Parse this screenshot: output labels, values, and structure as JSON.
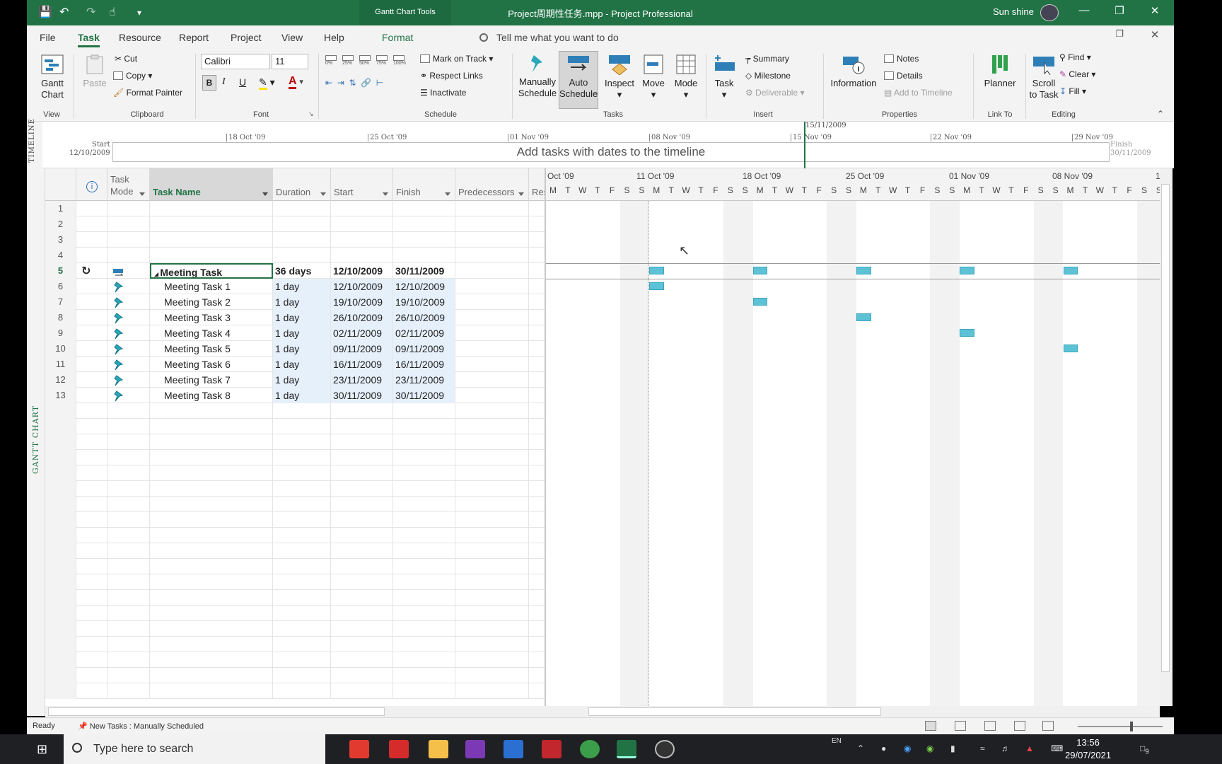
{
  "window": {
    "context_tab": "Gantt Chart Tools",
    "title": "Project周期性任务.mpp  -  Project Professional",
    "user": "Sun shine"
  },
  "menu": {
    "items": [
      "File",
      "Task",
      "Resource",
      "Report",
      "Project",
      "View",
      "Help",
      "Format"
    ],
    "active": "Task",
    "tell_me": "Tell me what you want to do"
  },
  "ribbon": {
    "view": {
      "gantt_chart": "Gantt\nChart",
      "label": "View"
    },
    "clipboard": {
      "paste": "Paste",
      "cut": "Cut",
      "copy": "Copy",
      "format_painter": "Format Painter",
      "label": "Clipboard"
    },
    "font": {
      "family": "Calibri",
      "size": "11",
      "bold": "B",
      "italic": "I",
      "underline": "U",
      "label": "Font"
    },
    "schedule": {
      "progress": [
        "0%",
        "25%",
        "50%",
        "75%",
        "100%"
      ],
      "mark_on_track": "Mark on Track",
      "respect_links": "Respect Links",
      "inactivate": "Inactivate",
      "label": "Schedule"
    },
    "tasks": {
      "manually": "Manually\nSchedule",
      "auto": "Auto\nSchedule",
      "inspect": "Inspect",
      "move": "Move",
      "mode": "Mode",
      "label": "Tasks"
    },
    "insert": {
      "task": "Task",
      "summary": "Summary",
      "milestone": "Milestone",
      "deliverable": "Deliverable",
      "label": "Insert"
    },
    "properties": {
      "information": "Information",
      "notes": "Notes",
      "details": "Details",
      "add_to_timeline": "Add to Timeline",
      "label": "Properties"
    },
    "link_to": {
      "planner": "Planner",
      "label": "Link To"
    },
    "editing": {
      "scroll_to_task": "Scroll\nto Task",
      "find": "Find",
      "clear": "Clear",
      "fill": "Fill",
      "label": "Editing"
    }
  },
  "timeline": {
    "side_label": "TIMELINE",
    "start_label": "Start",
    "start_date": "12/10/2009",
    "finish_label": "Finish",
    "finish_date": "30/11/2009",
    "current_date": "15/11/2009",
    "ticks": [
      "18 Oct '09",
      "25 Oct '09",
      "01 Nov '09",
      "08 Nov '09",
      "15 Nov '09",
      "22 Nov '09",
      "29 Nov '09"
    ],
    "placeholder": "Add tasks with dates to the timeline"
  },
  "sheet": {
    "side_label": "GANTT CHART",
    "columns": {
      "mode": "Task\nMode",
      "name": "Task Name",
      "duration": "Duration",
      "start": "Start",
      "finish": "Finish",
      "predecessors": "Predecessors",
      "resources": "Res"
    },
    "rows": [
      {
        "id": "1",
        "name": "",
        "duration": "",
        "start": "",
        "finish": ""
      },
      {
        "id": "2",
        "name": "",
        "duration": "",
        "start": "",
        "finish": ""
      },
      {
        "id": "3",
        "name": "",
        "duration": "",
        "start": "",
        "finish": ""
      },
      {
        "id": "4",
        "name": "",
        "duration": "",
        "start": "",
        "finish": ""
      },
      {
        "id": "5",
        "name": "Meeting Task",
        "duration": "36 days",
        "start": "12/10/2009",
        "finish": "30/11/2009",
        "summary": true
      },
      {
        "id": "6",
        "name": "Meeting Task 1",
        "duration": "1 day",
        "start": "12/10/2009",
        "finish": "12/10/2009"
      },
      {
        "id": "7",
        "name": "Meeting Task 2",
        "duration": "1 day",
        "start": "19/10/2009",
        "finish": "19/10/2009"
      },
      {
        "id": "8",
        "name": "Meeting Task 3",
        "duration": "1 day",
        "start": "26/10/2009",
        "finish": "26/10/2009"
      },
      {
        "id": "9",
        "name": "Meeting Task 4",
        "duration": "1 day",
        "start": "02/11/2009",
        "finish": "02/11/2009"
      },
      {
        "id": "10",
        "name": "Meeting Task 5",
        "duration": "1 day",
        "start": "09/11/2009",
        "finish": "09/11/2009"
      },
      {
        "id": "11",
        "name": "Meeting Task 6",
        "duration": "1 day",
        "start": "16/11/2009",
        "finish": "16/11/2009"
      },
      {
        "id": "12",
        "name": "Meeting Task 7",
        "duration": "1 day",
        "start": "23/11/2009",
        "finish": "23/11/2009"
      },
      {
        "id": "13",
        "name": "Meeting Task 8",
        "duration": "1 day",
        "start": "30/11/2009",
        "finish": "30/11/2009"
      }
    ]
  },
  "gantt": {
    "weeks": [
      "Oct '09",
      "11 Oct '09",
      "18 Oct '09",
      "25 Oct '09",
      "01 Nov '09",
      "08 Nov '09",
      "1"
    ],
    "days": [
      "M",
      "T",
      "W",
      "T",
      "F",
      "S",
      "S",
      "M",
      "T",
      "W",
      "T",
      "F",
      "S",
      "S",
      "M",
      "T",
      "W",
      "T",
      "F",
      "S",
      "S",
      "M",
      "T",
      "W",
      "T",
      "F",
      "S",
      "S",
      "M",
      "T",
      "W",
      "T",
      "F",
      "S",
      "S",
      "M",
      "T",
      "W",
      "T",
      "F",
      "S",
      "S"
    ],
    "colors": {
      "bar": "#5ec2d6",
      "accent": "#217346"
    }
  },
  "status": {
    "ready": "Ready",
    "new_tasks": "New Tasks : Manually Scheduled"
  },
  "taskbar": {
    "search_placeholder": "Type here to search",
    "lang": "EN",
    "time": "13:56",
    "date": "29/07/2021",
    "notifications": "9"
  }
}
